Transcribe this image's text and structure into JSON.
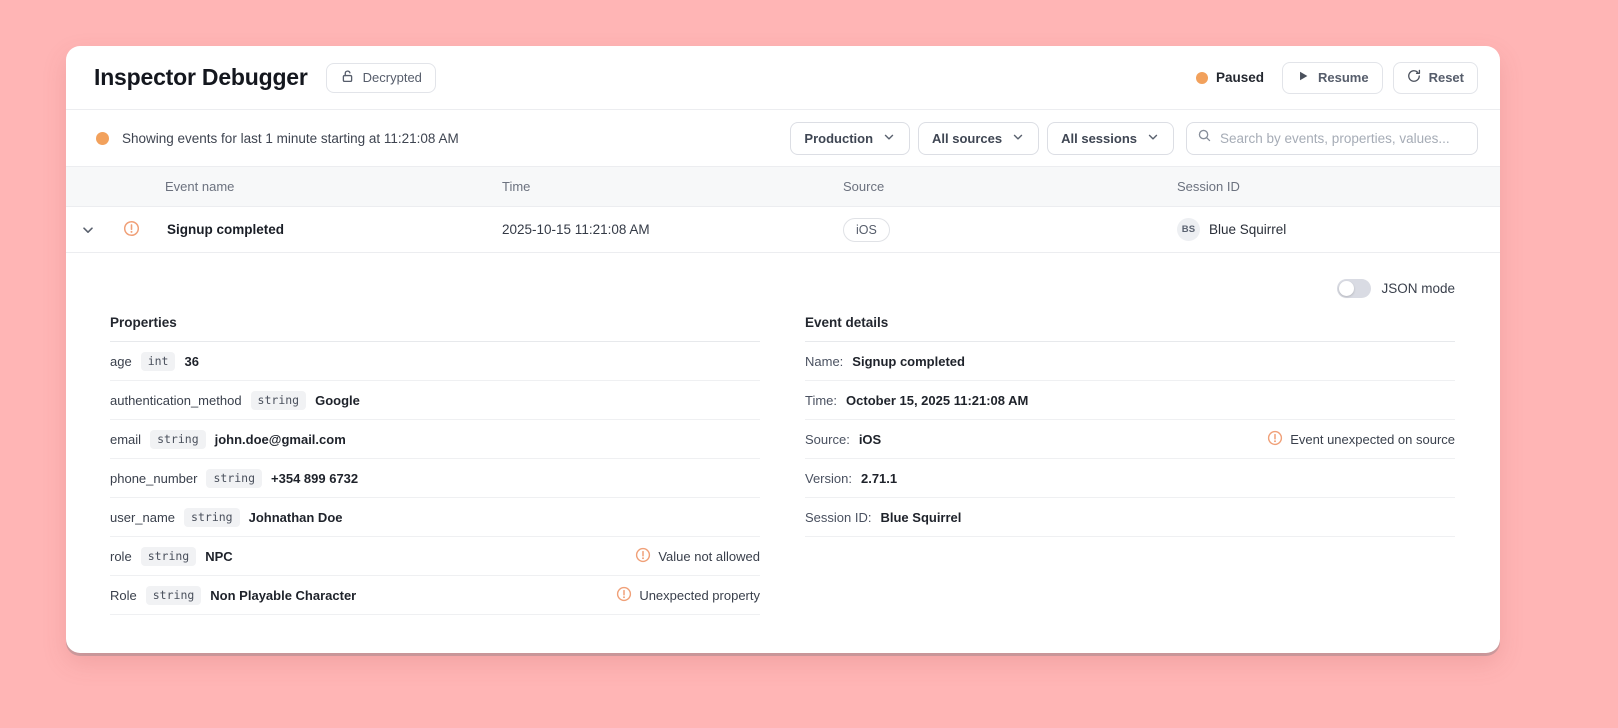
{
  "header": {
    "title": "Inspector Debugger",
    "decrypted_label": "Decrypted",
    "status_label": "Paused",
    "resume_label": "Resume",
    "reset_label": "Reset"
  },
  "filter_bar": {
    "status_text": "Showing events for last 1 minute starting at 11:21:08 AM",
    "environment": "Production",
    "sources": "All sources",
    "sessions": "All sessions",
    "search_placeholder": "Search by events, properties, values..."
  },
  "table": {
    "columns": [
      "Event name",
      "Time",
      "Source",
      "Session ID"
    ],
    "row": {
      "event_name": "Signup completed",
      "time": "2025-10-15 11:21:08 AM",
      "source": "iOS",
      "session_initials": "BS",
      "session_name": "Blue Squirrel"
    }
  },
  "details": {
    "json_mode_label": "JSON mode",
    "properties": {
      "title": "Properties",
      "rows": [
        {
          "key": "age",
          "type": "int",
          "value": "36"
        },
        {
          "key": "authentication_method",
          "type": "string",
          "value": "Google"
        },
        {
          "key": "email",
          "type": "string",
          "value": "john.doe@gmail.com"
        },
        {
          "key": "phone_number",
          "type": "string",
          "value": "+354 899 6732"
        },
        {
          "key": "user_name",
          "type": "string",
          "value": "Johnathan Doe"
        },
        {
          "key": "role",
          "type": "string",
          "value": "NPC",
          "warning": "Value not allowed"
        },
        {
          "key": "Role",
          "type": "string",
          "value": "Non Playable Character",
          "warning": "Unexpected property"
        }
      ]
    },
    "event_details": {
      "title": "Event details",
      "rows": [
        {
          "label": "Name:",
          "value": "Signup completed"
        },
        {
          "label": "Time:",
          "value": "October 15, 2025 11:21:08 AM"
        },
        {
          "label": "Source:",
          "value": "iOS",
          "warning": "Event unexpected on source"
        },
        {
          "label": "Version:",
          "value": "2.71.1"
        },
        {
          "label": "Session ID:",
          "value": "Blue Squirrel"
        }
      ]
    }
  },
  "colors": {
    "background": "#FFB5B5",
    "accent_orange": "#F2A15C",
    "warning_icon": "#F0A078"
  }
}
